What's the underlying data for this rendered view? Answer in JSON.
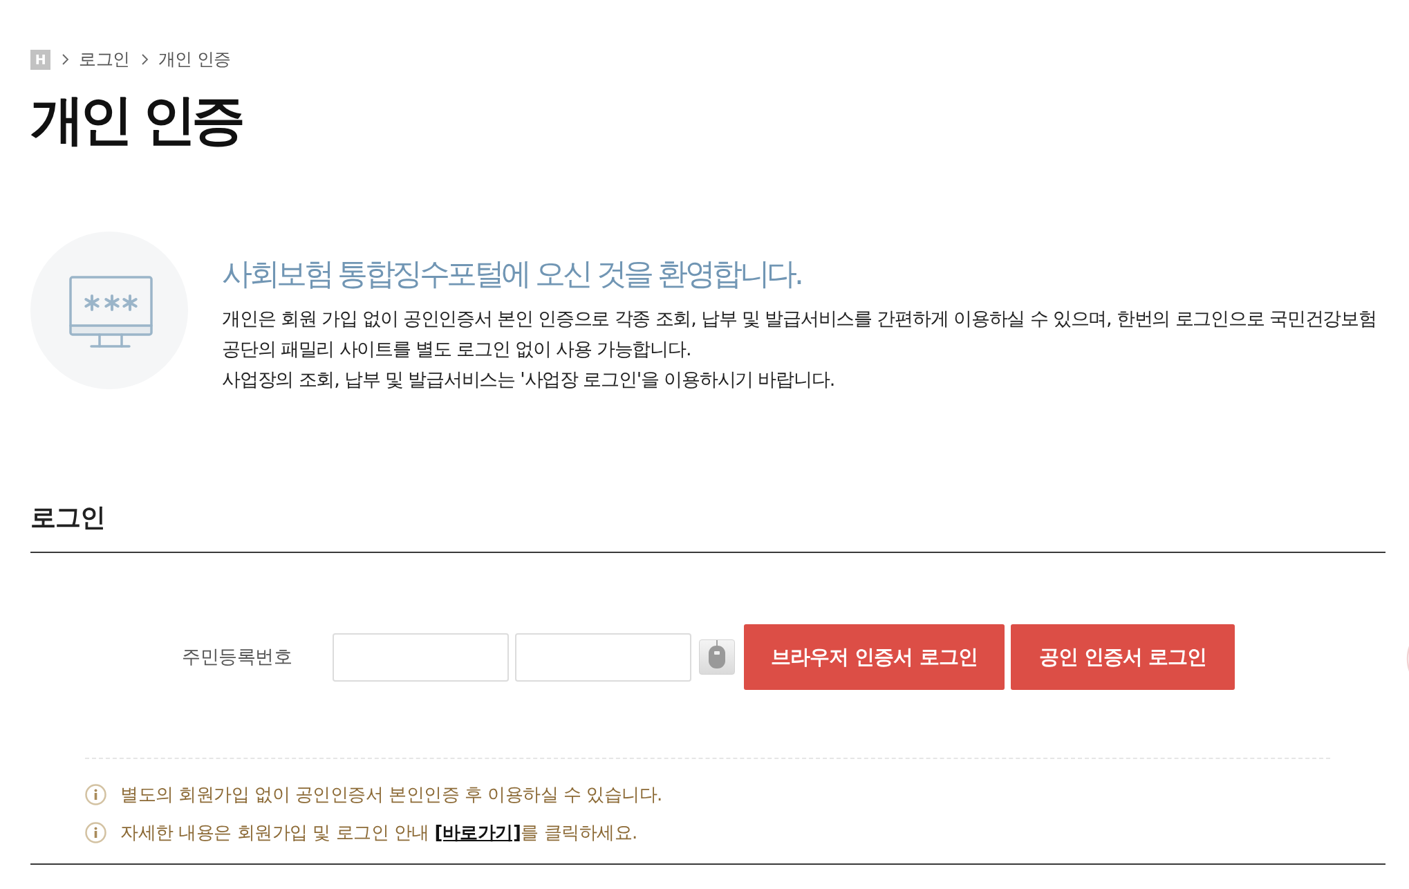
{
  "breadcrumb": {
    "home_label": "H",
    "items": [
      {
        "label": "로그인"
      },
      {
        "label": "개인 인증"
      }
    ]
  },
  "page_title": "개인 인증",
  "welcome": {
    "heading": "사회보험 통합징수포털에 오신 것을 환영합니다.",
    "paragraphs": [
      "개인은 회원 가입 없이 공인인증서 본인 인증으로 각종 조회, 납부 및 발급서비스를 간편하게 이용하실 수 있으며, 한번의 로그인으로 국민건강보험 공단의 패밀리 사이트를 별도 로그인 없이 사용 가능합니다.",
      "사업장의 조회, 납부 및 발급서비스는 '사업장 로그인'을 이용하시기 바랍니다."
    ]
  },
  "login": {
    "heading": "로그인",
    "field_label": "주민등록번호",
    "buttons": [
      {
        "label": "브라우저 인증서 로그인"
      },
      {
        "label": "공인 인증서 로그인"
      }
    ]
  },
  "notes": [
    {
      "text": "별도의 회원가입 없이 공인인증서 본인인증 후 이용하실 수 있습니다."
    },
    {
      "text": "자세한 내용은 회원가입 및 로그인 안내 ",
      "link": "[바로가기]",
      "text_after": "를 클릭하세요."
    }
  ]
}
